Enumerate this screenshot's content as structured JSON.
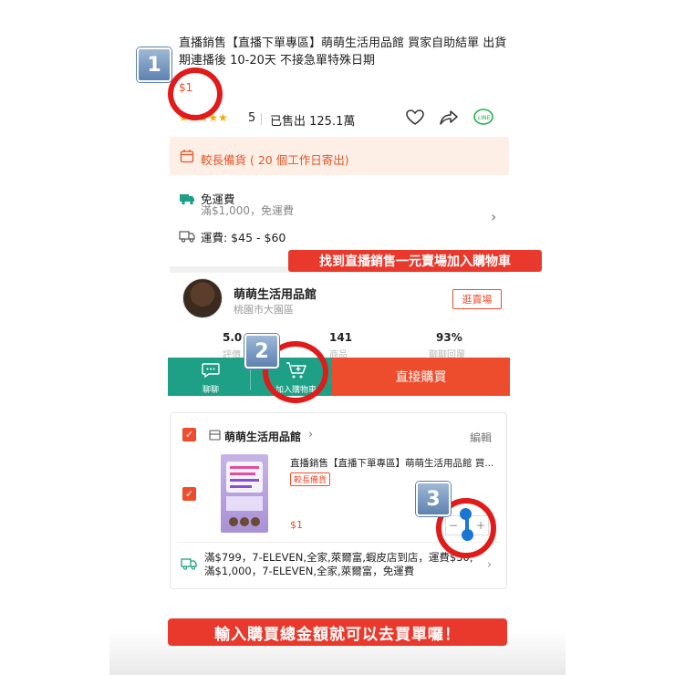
{
  "product": {
    "title": "直播銷售【直播下單專區】萌萌生活用品館 買家自助結單 出貨期連播後 10-20天 不接急單特殊日期",
    "price": "$1",
    "rating": "5",
    "sold": "已售出 125.1萬"
  },
  "notice": {
    "text": "較長備貨 ( 20 個工作日寄出)"
  },
  "shipping": {
    "free_label": "免運費",
    "free_sub": "滿$1,000，免運費",
    "fee_label": "運費: $45 - $60"
  },
  "banners": {
    "top": "找到直播銷售一元賣場加入購物車",
    "bottom": "輸入購買總金額就可以去買單囉！"
  },
  "shop": {
    "name": "萌萌生活用品館",
    "location": "桃園市大園區",
    "visit_label": "逛賣場",
    "stats": [
      {
        "value": "5.0",
        "label": "評價"
      },
      {
        "value": "141",
        "label": "商品"
      },
      {
        "value": "93%",
        "label": "聊聊回覆"
      }
    ]
  },
  "action_bar": {
    "chat_label": "聊聊",
    "add_cart_label": "加入購物車",
    "buy_label": "直接購買"
  },
  "cart": {
    "shop_name": "萌萌生活用品館",
    "edit_label": "編輯",
    "item_title": "直播銷售【直播下單專區】萌萌生活用品館 買...",
    "item_tag": "較長備貨",
    "item_price": "$1",
    "shipping_note": "滿$799，7-ELEVEN,全家,萊爾富,蝦皮店到店，運費$30; 滿$1,000，7-ELEVEN,全家,萊爾富，免運費"
  },
  "steps": [
    "1",
    "2",
    "3"
  ],
  "colors": {
    "accent": "#ee4d2d",
    "teal": "#1ea086",
    "ring": "#e11a1a",
    "banner": "#e8392c"
  }
}
